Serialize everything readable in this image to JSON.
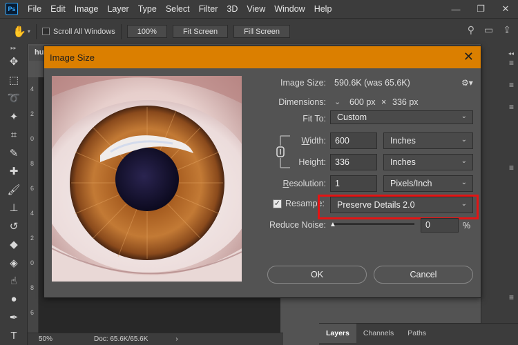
{
  "app": {
    "logo": "Ps"
  },
  "menu": [
    "File",
    "Edit",
    "Image",
    "Layer",
    "Type",
    "Select",
    "Filter",
    "3D",
    "View",
    "Window",
    "Help"
  ],
  "window_controls": {
    "minimize": "—",
    "restore": "❐",
    "close": "✕"
  },
  "options_bar": {
    "scroll_all_windows": "Scroll All Windows",
    "zoom_value": "100%",
    "fit_screen": "Fit Screen",
    "fill_screen": "Fill Screen"
  },
  "document": {
    "tab_label": "hu",
    "ruler_marks": [
      "4",
      "2",
      "0",
      "8",
      "6",
      "4",
      "2",
      "0",
      "8",
      "6",
      "4",
      "2",
      "0",
      "8",
      "6"
    ],
    "zoom": "50%",
    "doc_size": "Doc: 65.6K/65.6K"
  },
  "layers_panel": {
    "tabs": [
      "Layers",
      "Channels",
      "Paths"
    ]
  },
  "dialog": {
    "title": "Image Size",
    "image_size_label": "Image Size:",
    "image_size_value": "590.6K (was 65.6K)",
    "dimensions_label": "Dimensions:",
    "dimensions_w": "600 px",
    "dimensions_x": "×",
    "dimensions_h": "336 px",
    "fit_to_label": "Fit To:",
    "fit_to_value": "Custom",
    "width_label_pre": "",
    "width_label_u": "W",
    "width_label_post": "idth:",
    "width_value": "600",
    "width_unit": "Inches",
    "height_label_pre": "Hei",
    "height_label_u": "g",
    "height_label_post": "ht:",
    "height_value": "336",
    "height_unit": "Inches",
    "resolution_label_pre": "",
    "resolution_label_u": "R",
    "resolution_label_post": "esolution:",
    "resolution_value": "1",
    "resolution_unit": "Pixels/Inch",
    "resample_label_pre": "Resamp",
    "resample_label_post": "e:",
    "resample_checked": true,
    "resample_value": "Preserve Details 2.0",
    "reduce_noise_label": "Reduce Noise:",
    "reduce_noise_value": "0",
    "reduce_noise_unit": "%",
    "ok": "OK",
    "cancel": "Cancel"
  },
  "colors": {
    "accent": "#db7f00",
    "highlight": "#e41414"
  }
}
